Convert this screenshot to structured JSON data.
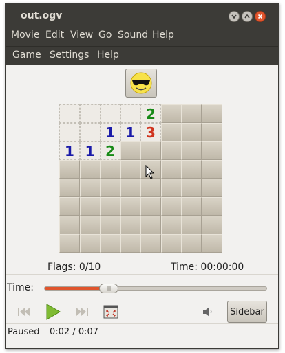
{
  "window": {
    "title": "out.ogv"
  },
  "menubar": {
    "items": [
      "Movie",
      "Edit",
      "View",
      "Go",
      "Sound",
      "Help"
    ]
  },
  "game_menu": {
    "items": [
      "Game",
      "Settings",
      "Help"
    ]
  },
  "game": {
    "smiley_icon": "cool-smiley-with-sunglasses",
    "flags_text": "Flags: 0/10",
    "time_text": "Time: 00:00:00",
    "grid": [
      [
        "open",
        "open",
        "open",
        "open",
        "2",
        "hidden",
        "hidden",
        "hidden"
      ],
      [
        "open",
        "open",
        "1",
        "1",
        "3",
        "hidden",
        "hidden",
        "hidden"
      ],
      [
        "1",
        "1",
        "2",
        "hidden",
        "hidden",
        "hidden",
        "hidden",
        "hidden"
      ],
      [
        "hidden",
        "hidden",
        "hidden",
        "hidden",
        "hidden",
        "hidden",
        "hidden",
        "hidden"
      ],
      [
        "hidden",
        "hidden",
        "hidden",
        "hidden",
        "hidden",
        "hidden",
        "hidden",
        "hidden"
      ],
      [
        "hidden",
        "hidden",
        "hidden",
        "hidden",
        "hidden",
        "hidden",
        "hidden",
        "hidden"
      ],
      [
        "hidden",
        "hidden",
        "hidden",
        "hidden",
        "hidden",
        "hidden",
        "hidden",
        "hidden"
      ],
      [
        "hidden",
        "hidden",
        "hidden",
        "hidden",
        "hidden",
        "hidden",
        "hidden",
        "hidden"
      ]
    ]
  },
  "player": {
    "time_label": "Time:",
    "progress_fraction": 0.29,
    "sidebar_label": "Sidebar",
    "status": "Paused",
    "position": "0:02 / 0:07"
  },
  "colors": {
    "accent": "#e0552d",
    "titlebar": "#3c3b37",
    "one": "#1a1aa8",
    "two": "#178a17",
    "three": "#d0341e"
  }
}
